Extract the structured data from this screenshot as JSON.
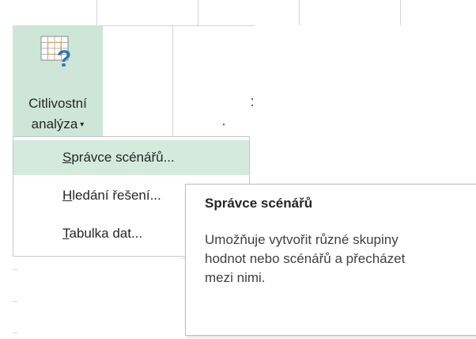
{
  "ribbon": {
    "button_label_line1": "Citlivostní",
    "button_label_line2": "analýza",
    "dropdown_caret": "▾",
    "icon": "what-if-analysis-icon",
    "active_color": "#cde6d7"
  },
  "menu": {
    "items": [
      {
        "accel": "S",
        "rest": "právce scénářů...",
        "highlighted": true
      },
      {
        "accel": "H",
        "rest": "ledání řešení...",
        "highlighted": false
      },
      {
        "accel": "T",
        "rest": "abulka dat...",
        "highlighted": false
      }
    ],
    "highlight_color": "#d3eadd"
  },
  "tooltip": {
    "title": "Správce scénářů",
    "body": "Umožňuje vytvořit různé skupiny hodnot nebo scénářů a přecházet mezi nimi."
  }
}
